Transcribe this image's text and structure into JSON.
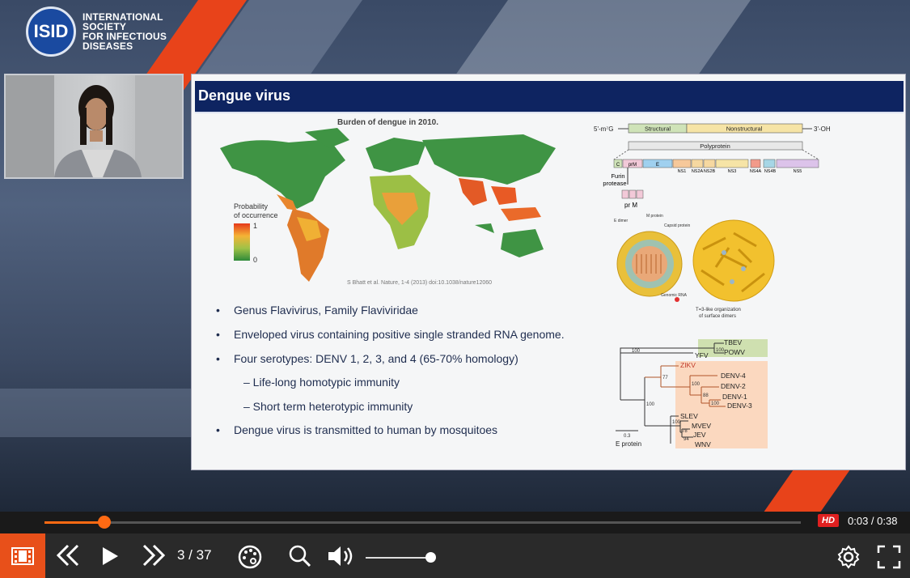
{
  "logo": {
    "abbr": "ISID",
    "line1": "INTERNATIONAL",
    "line2": "SOCIETY",
    "line3": "FOR INFECTIOUS",
    "line4": "DISEASES"
  },
  "slide": {
    "title": "Dengue virus",
    "map_title": "Burden of dengue in 2010.",
    "legend_title_1": "Probability",
    "legend_title_2": "of occurrence",
    "legend_max": "1",
    "legend_min": "0",
    "citation": "S Bhatt et al. Nature, 1-4 (2013) doi:10.1038/nature12060",
    "bullets": [
      {
        "dot": "•",
        "text": "Genus Flavivirus, Family Flaviviridae"
      },
      {
        "dot": "•",
        "text": "Enveloped virus containing positive single stranded RNA genome."
      },
      {
        "dot": "•",
        "text": "Four serotypes: DENV 1, 2, 3, and 4  (65-70% homology)"
      },
      {
        "dot": "",
        "text": "– Life-long homotypic immunity"
      },
      {
        "dot": "",
        "text": "– Short term heterotypic immunity"
      },
      {
        "dot": "•",
        "text": "Dengue virus is transmitted to human by mosquitoes"
      }
    ],
    "genome": {
      "five_prime": "5'-m⁷G",
      "three_prime": "3'-OH",
      "structural": "Structural",
      "nonstructural": "Nonstructural",
      "polyprotein": "Polyprotein",
      "proteins": [
        "C",
        "prM",
        "E",
        "NS1",
        "NS2A",
        "NS2B",
        "NS3",
        "NS4A",
        "NS4B",
        "NS5"
      ],
      "furin": "Furin",
      "protease": "protease",
      "pr_m": "pr  M"
    },
    "virion": {
      "e_dimer": "E dimer",
      "m_protein": "M protein",
      "capsid": "Capsid protein",
      "genomic_rna": "Genomic RNA",
      "t3_1": "T=3-like organization",
      "t3_2": "of surface dimers"
    },
    "tree": {
      "taxa": [
        "TBEV",
        "POWV",
        "YFV",
        "ZIKV",
        "DENV-4",
        "DENV-2",
        "DENV-1",
        "DENV-3",
        "SLEV",
        "MVEV",
        "JEV",
        "WNV"
      ],
      "bootstrap": [
        "100",
        "100",
        "77",
        "100",
        "100",
        "88",
        "100",
        "100",
        "78",
        "94"
      ],
      "scale": "0.3",
      "protein": "E protein"
    }
  },
  "player": {
    "progress_fraction": 0.0789,
    "hd": "HD",
    "time": "0:03 / 0:38",
    "page": "3 / 37",
    "volume_fraction": 0.95,
    "accent": "#ff6a13",
    "icons": [
      "film-icon",
      "previous-icon",
      "play-icon",
      "next-icon",
      "palette-icon",
      "search-icon",
      "volume-icon",
      "settings-icon",
      "fullscreen-icon"
    ]
  }
}
